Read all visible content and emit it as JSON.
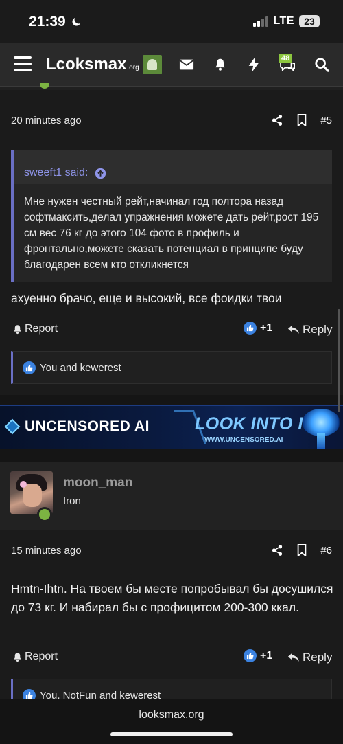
{
  "status": {
    "time": "21:39",
    "network": "LTE",
    "battery": "23"
  },
  "nav": {
    "logo_main": "Lcoksmax",
    "logo_suffix": ".org",
    "alerts_count": "48"
  },
  "post5": {
    "time": "20 minutes ago",
    "number": "#5",
    "quote_author": "sweeft1 said:",
    "quote_text": "Мне нужен честный рейт,начинал год полтора назад софтмаксить,делал упражнения можете дать рейт,рост 195 см вес 76 кг до этого 104 фото в профиль и фронтально,можете сказать потенциал в принципе буду благодарен всем кто откликнется",
    "text": "ахуенно брачо, еще и высокий, все фоидки твои",
    "report_label": "Report",
    "like_count": "+1",
    "reply_label": "Reply",
    "likes_text": "You and kewerest"
  },
  "ad": {
    "left_text": "UNCENSORED AI",
    "right_text": "LOOK INTO IT",
    "url": "WWW.UNCENSORED.AI"
  },
  "post6": {
    "author": "moon_man",
    "author_title": "Iron",
    "time": "15 minutes ago",
    "number": "#6",
    "text": "Hmtn-Ihtn. На твоем бы месте попробывал бы досушился до 73 кг. И набирал бы с профицитом 200-300 ккал.",
    "report_label": "Report",
    "like_count": "+1",
    "reply_label": "Reply",
    "likes_text": "You, NotFun and kewerest"
  },
  "browser": {
    "url": "looksmax.org"
  }
}
